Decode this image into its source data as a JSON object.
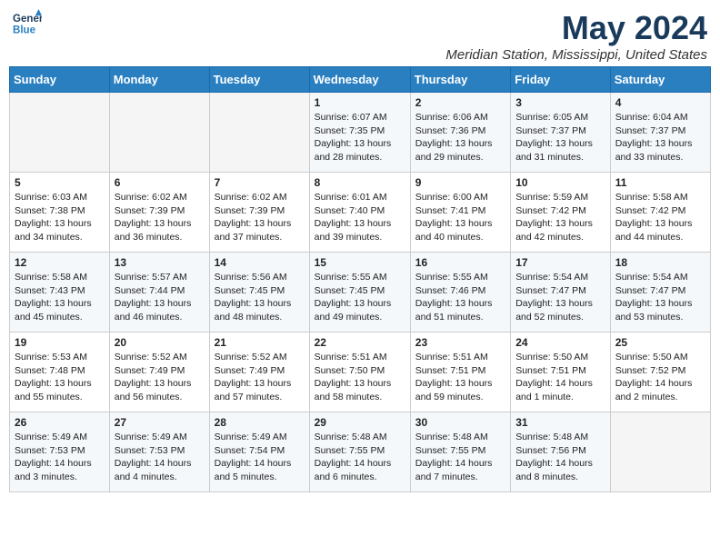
{
  "logo": {
    "line1": "General",
    "line2": "Blue"
  },
  "title": "May 2024",
  "location": "Meridian Station, Mississippi, United States",
  "days_of_week": [
    "Sunday",
    "Monday",
    "Tuesday",
    "Wednesday",
    "Thursday",
    "Friday",
    "Saturday"
  ],
  "weeks": [
    [
      {
        "day": "",
        "text": ""
      },
      {
        "day": "",
        "text": ""
      },
      {
        "day": "",
        "text": ""
      },
      {
        "day": "1",
        "text": "Sunrise: 6:07 AM\nSunset: 7:35 PM\nDaylight: 13 hours and 28 minutes."
      },
      {
        "day": "2",
        "text": "Sunrise: 6:06 AM\nSunset: 7:36 PM\nDaylight: 13 hours and 29 minutes."
      },
      {
        "day": "3",
        "text": "Sunrise: 6:05 AM\nSunset: 7:37 PM\nDaylight: 13 hours and 31 minutes."
      },
      {
        "day": "4",
        "text": "Sunrise: 6:04 AM\nSunset: 7:37 PM\nDaylight: 13 hours and 33 minutes."
      }
    ],
    [
      {
        "day": "5",
        "text": "Sunrise: 6:03 AM\nSunset: 7:38 PM\nDaylight: 13 hours and 34 minutes."
      },
      {
        "day": "6",
        "text": "Sunrise: 6:02 AM\nSunset: 7:39 PM\nDaylight: 13 hours and 36 minutes."
      },
      {
        "day": "7",
        "text": "Sunrise: 6:02 AM\nSunset: 7:39 PM\nDaylight: 13 hours and 37 minutes."
      },
      {
        "day": "8",
        "text": "Sunrise: 6:01 AM\nSunset: 7:40 PM\nDaylight: 13 hours and 39 minutes."
      },
      {
        "day": "9",
        "text": "Sunrise: 6:00 AM\nSunset: 7:41 PM\nDaylight: 13 hours and 40 minutes."
      },
      {
        "day": "10",
        "text": "Sunrise: 5:59 AM\nSunset: 7:42 PM\nDaylight: 13 hours and 42 minutes."
      },
      {
        "day": "11",
        "text": "Sunrise: 5:58 AM\nSunset: 7:42 PM\nDaylight: 13 hours and 44 minutes."
      }
    ],
    [
      {
        "day": "12",
        "text": "Sunrise: 5:58 AM\nSunset: 7:43 PM\nDaylight: 13 hours and 45 minutes."
      },
      {
        "day": "13",
        "text": "Sunrise: 5:57 AM\nSunset: 7:44 PM\nDaylight: 13 hours and 46 minutes."
      },
      {
        "day": "14",
        "text": "Sunrise: 5:56 AM\nSunset: 7:45 PM\nDaylight: 13 hours and 48 minutes."
      },
      {
        "day": "15",
        "text": "Sunrise: 5:55 AM\nSunset: 7:45 PM\nDaylight: 13 hours and 49 minutes."
      },
      {
        "day": "16",
        "text": "Sunrise: 5:55 AM\nSunset: 7:46 PM\nDaylight: 13 hours and 51 minutes."
      },
      {
        "day": "17",
        "text": "Sunrise: 5:54 AM\nSunset: 7:47 PM\nDaylight: 13 hours and 52 minutes."
      },
      {
        "day": "18",
        "text": "Sunrise: 5:54 AM\nSunset: 7:47 PM\nDaylight: 13 hours and 53 minutes."
      }
    ],
    [
      {
        "day": "19",
        "text": "Sunrise: 5:53 AM\nSunset: 7:48 PM\nDaylight: 13 hours and 55 minutes."
      },
      {
        "day": "20",
        "text": "Sunrise: 5:52 AM\nSunset: 7:49 PM\nDaylight: 13 hours and 56 minutes."
      },
      {
        "day": "21",
        "text": "Sunrise: 5:52 AM\nSunset: 7:49 PM\nDaylight: 13 hours and 57 minutes."
      },
      {
        "day": "22",
        "text": "Sunrise: 5:51 AM\nSunset: 7:50 PM\nDaylight: 13 hours and 58 minutes."
      },
      {
        "day": "23",
        "text": "Sunrise: 5:51 AM\nSunset: 7:51 PM\nDaylight: 13 hours and 59 minutes."
      },
      {
        "day": "24",
        "text": "Sunrise: 5:50 AM\nSunset: 7:51 PM\nDaylight: 14 hours and 1 minute."
      },
      {
        "day": "25",
        "text": "Sunrise: 5:50 AM\nSunset: 7:52 PM\nDaylight: 14 hours and 2 minutes."
      }
    ],
    [
      {
        "day": "26",
        "text": "Sunrise: 5:49 AM\nSunset: 7:53 PM\nDaylight: 14 hours and 3 minutes."
      },
      {
        "day": "27",
        "text": "Sunrise: 5:49 AM\nSunset: 7:53 PM\nDaylight: 14 hours and 4 minutes."
      },
      {
        "day": "28",
        "text": "Sunrise: 5:49 AM\nSunset: 7:54 PM\nDaylight: 14 hours and 5 minutes."
      },
      {
        "day": "29",
        "text": "Sunrise: 5:48 AM\nSunset: 7:55 PM\nDaylight: 14 hours and 6 minutes."
      },
      {
        "day": "30",
        "text": "Sunrise: 5:48 AM\nSunset: 7:55 PM\nDaylight: 14 hours and 7 minutes."
      },
      {
        "day": "31",
        "text": "Sunrise: 5:48 AM\nSunset: 7:56 PM\nDaylight: 14 hours and 8 minutes."
      },
      {
        "day": "",
        "text": ""
      }
    ]
  ]
}
